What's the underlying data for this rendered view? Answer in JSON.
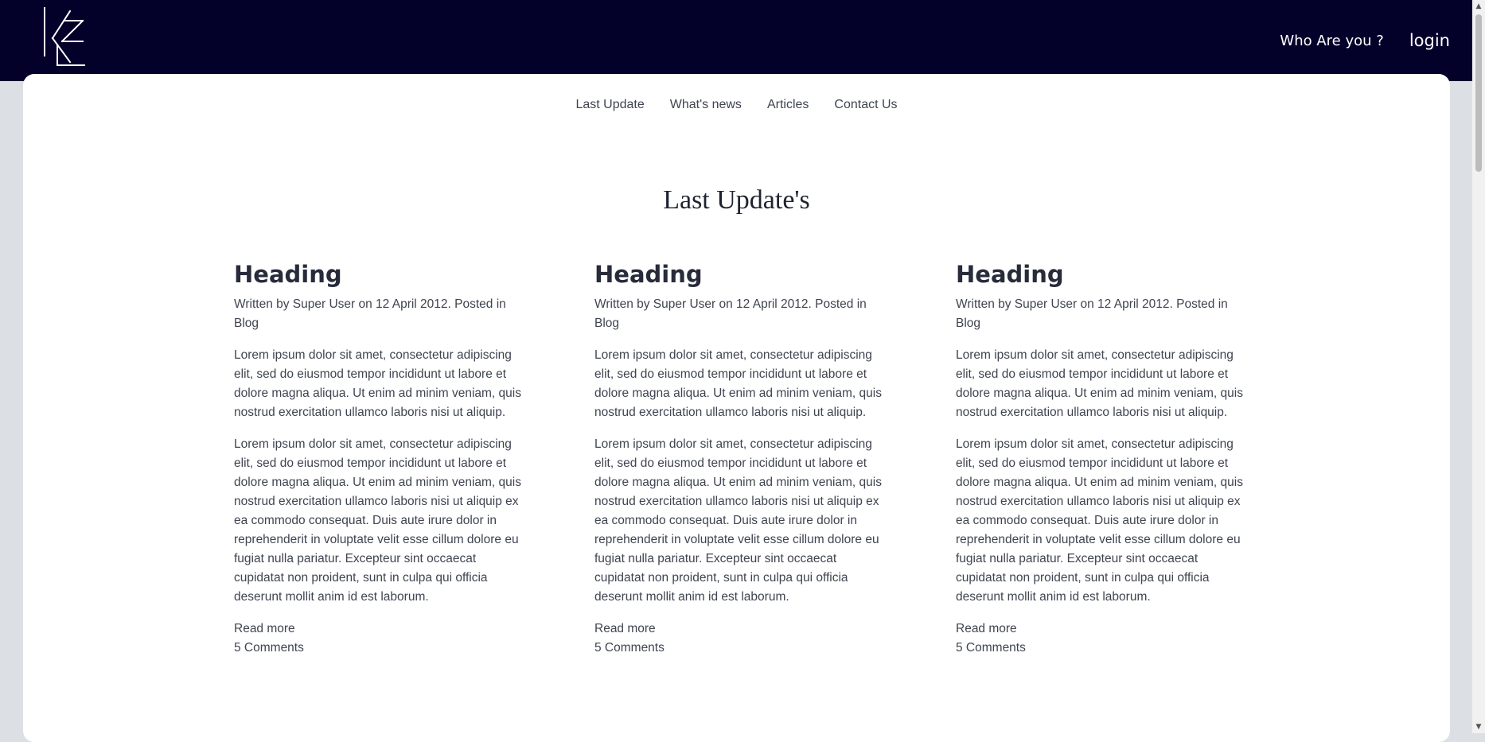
{
  "header": {
    "logo_text": "KE",
    "who_label": "Who Are you ?",
    "login_label": "login"
  },
  "nav": {
    "items": [
      {
        "label": "Last Update"
      },
      {
        "label": "What's news"
      },
      {
        "label": "Articles"
      },
      {
        "label": "Contact Us"
      }
    ]
  },
  "section": {
    "title": "Last Update's"
  },
  "articles": [
    {
      "heading": "Heading",
      "meta": "Written by Super User on 12 April 2012. Posted in Blog",
      "para1": "Lorem ipsum dolor sit amet, consectetur adipiscing elit, sed do eiusmod tempor incididunt ut labore et dolore magna aliqua. Ut enim ad minim veniam, quis nostrud exercitation ullamco laboris nisi ut aliquip.",
      "para2": "Lorem ipsum dolor sit amet, consectetur adipiscing elit, sed do eiusmod tempor incididunt ut labore et dolore magna aliqua. Ut enim ad minim veniam, quis nostrud exercitation ullamco laboris nisi ut aliquip ex ea commodo consequat. Duis aute irure dolor in reprehenderit in voluptate velit esse cillum dolore eu fugiat nulla pariatur. Excepteur sint occaecat cupidatat non proident, sunt in culpa qui officia deserunt mollit anim id est laborum.",
      "read_more": "Read more",
      "comments": "5 Comments"
    },
    {
      "heading": "Heading",
      "meta": "Written by Super User on 12 April 2012. Posted in Blog",
      "para1": "Lorem ipsum dolor sit amet, consectetur adipiscing elit, sed do eiusmod tempor incididunt ut labore et dolore magna aliqua. Ut enim ad minim veniam, quis nostrud exercitation ullamco laboris nisi ut aliquip.",
      "para2": "Lorem ipsum dolor sit amet, consectetur adipiscing elit, sed do eiusmod tempor incididunt ut labore et dolore magna aliqua. Ut enim ad minim veniam, quis nostrud exercitation ullamco laboris nisi ut aliquip ex ea commodo consequat. Duis aute irure dolor in reprehenderit in voluptate velit esse cillum dolore eu fugiat nulla pariatur. Excepteur sint occaecat cupidatat non proident, sunt in culpa qui officia deserunt mollit anim id est laborum.",
      "read_more": "Read more",
      "comments": "5 Comments"
    },
    {
      "heading": "Heading",
      "meta": "Written by Super User on 12 April 2012. Posted in Blog",
      "para1": "Lorem ipsum dolor sit amet, consectetur adipiscing elit, sed do eiusmod tempor incididunt ut labore et dolore magna aliqua. Ut enim ad minim veniam, quis nostrud exercitation ullamco laboris nisi ut aliquip.",
      "para2": "Lorem ipsum dolor sit amet, consectetur adipiscing elit, sed do eiusmod tempor incididunt ut labore et dolore magna aliqua. Ut enim ad minim veniam, quis nostrud exercitation ullamco laboris nisi ut aliquip ex ea commodo consequat. Duis aute irure dolor in reprehenderit in voluptate velit esse cillum dolore eu fugiat nulla pariatur. Excepteur sint occaecat cupidatat non proident, sunt in culpa qui officia deserunt mollit anim id est laborum.",
      "read_more": "Read more",
      "comments": "5 Comments"
    }
  ],
  "colors": {
    "header_bg": "#03012a",
    "page_bg": "#dcdfe3",
    "card_bg": "#ffffff",
    "text": "#3f4450",
    "heading": "#272b3a"
  },
  "icons": {
    "logo": "ke-monogram-logo",
    "scroll_up": "scroll-up-arrow-icon",
    "scroll_down": "scroll-down-arrow-icon"
  }
}
